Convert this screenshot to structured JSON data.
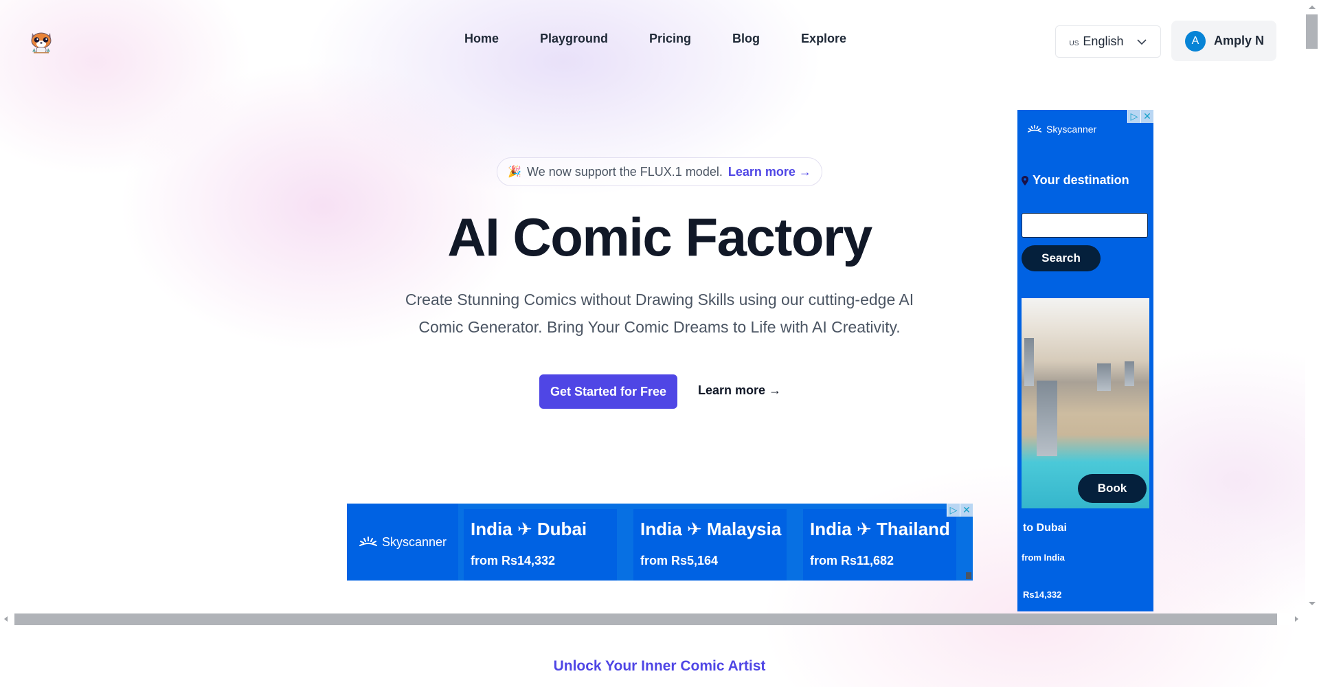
{
  "header": {
    "logo_alt": "AI Comic Factory logo",
    "nav": [
      {
        "label": "Home"
      },
      {
        "label": "Playground"
      },
      {
        "label": "Pricing"
      },
      {
        "label": "Blog"
      },
      {
        "label": "Explore"
      }
    ],
    "language": {
      "flag": "US",
      "label": "English"
    },
    "user": {
      "initial": "A",
      "name": "Amply N"
    }
  },
  "hero": {
    "announcement": {
      "emoji": "🎉",
      "text": "We now support the FLUX.1 model.",
      "link": "Learn more →"
    },
    "title": "AI Comic Factory",
    "subtitle": "Create Stunning Comics without Drawing Skills using our cutting-edge AI Comic Generator. Bring Your Comic Dreams to Life with AI Creativity.",
    "cta_primary": "Get Started for Free",
    "cta_secondary": "Learn more →"
  },
  "ad_banner": {
    "brand": "Skyscanner",
    "cards": [
      {
        "route": "India ✈ Dubai",
        "price": "from Rs14,332"
      },
      {
        "route": "India ✈ Malaysia",
        "price": "from Rs5,164"
      },
      {
        "route": "India ✈ Thailand",
        "price": "from Rs11,682"
      }
    ],
    "adchoices_icon": "▷",
    "close_icon": "✕"
  },
  "ad_side": {
    "brand": "Skyscanner",
    "destination_label": "Your destination",
    "input_value": "",
    "search_label": "Search",
    "book_label": "Book",
    "to": "to Dubai",
    "from": "from India",
    "price": "Rs14,332",
    "adchoices_icon": "▷",
    "close_icon": "✕"
  },
  "section": {
    "kicker": "Unlock Your Inner Comic Artist"
  },
  "colors": {
    "accent": "#4f46e5",
    "ad_blue": "#0062e3",
    "ad_dark": "#05203c",
    "avatar": "#0784d6"
  }
}
